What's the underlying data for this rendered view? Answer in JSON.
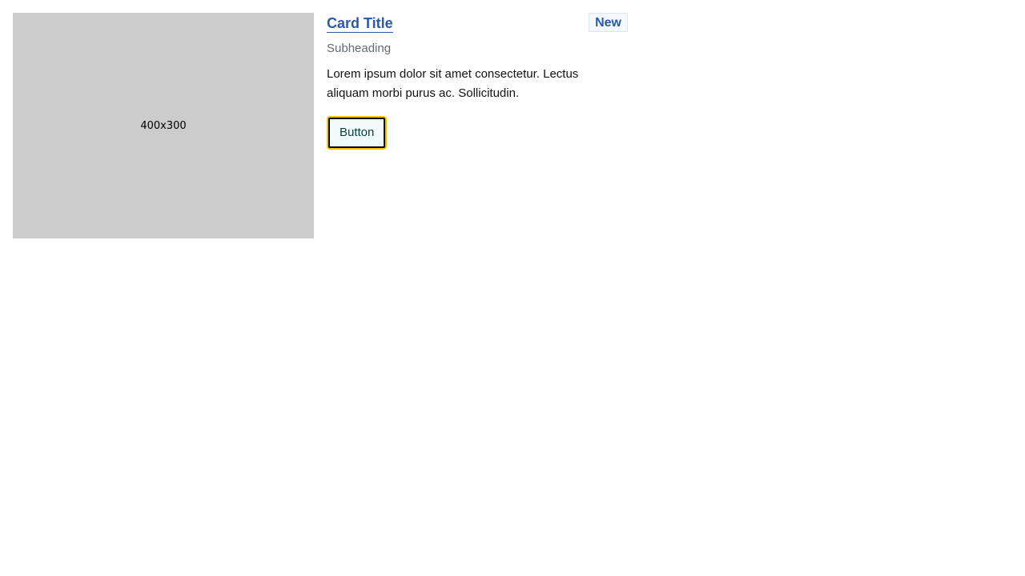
{
  "card": {
    "image_label": "400x300",
    "title": "Card Title",
    "badge": "New",
    "subheading": "Subheading",
    "description": "Lorem ipsum dolor sit amet consectetur. Lectus aliquam morbi purus ac. Sollicitudin.",
    "button_label": "Button",
    "colors": {
      "title": "#2b5aa6",
      "badge_text": "#2b5aa6",
      "badge_bg": "#f3f8ff",
      "badge_border": "#d6e6ff",
      "focus_ring": "#f3c400",
      "button_bg": "#f1fbfb",
      "button_text": "#0b3b3f",
      "subheading": "#666a73",
      "image_placeholder": "#cccccc"
    }
  }
}
